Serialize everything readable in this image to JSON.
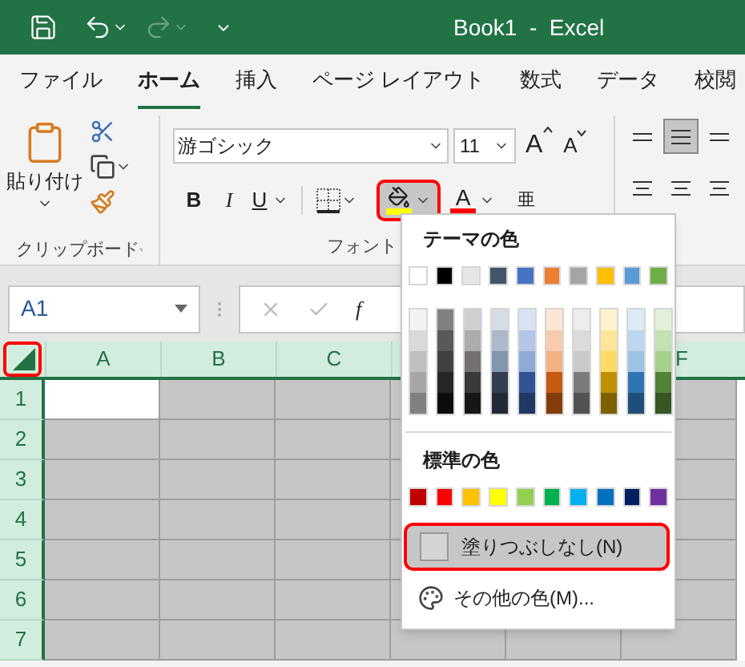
{
  "window": {
    "title": "Book1  -  Excel"
  },
  "quick_access": {
    "redo_disabled": true
  },
  "tabs": [
    {
      "label": "ファイル",
      "selected": false
    },
    {
      "label": "ホーム",
      "selected": true
    },
    {
      "label": "挿入",
      "selected": false
    },
    {
      "label": "ページ レイアウト",
      "selected": false
    },
    {
      "label": "数式",
      "selected": false
    },
    {
      "label": "データ",
      "selected": false
    },
    {
      "label": "校閲",
      "selected": false
    }
  ],
  "clipboard_group": {
    "paste_label": "貼り付け",
    "group_label": "クリップボード"
  },
  "font_group": {
    "font_name": "游ゴシック",
    "font_size": "11",
    "grow_label": "A",
    "shrink_label": "A",
    "bold_label": "B",
    "italic_label": "I",
    "underline_label": "U",
    "fill_bar": {
      "color": "#ffff00"
    },
    "fill_highlighted": true,
    "font_color_label": "A",
    "font_color_bar": {
      "color": "#ff0000"
    },
    "phonetic_label": "亜",
    "group_label": "フォント"
  },
  "alignment_buttons": [
    {
      "selected": false
    },
    {
      "selected": true
    },
    {
      "selected": false
    }
  ],
  "formula_bar": {
    "name_box": "A1",
    "function_label": "f"
  },
  "grid": {
    "select_all_highlighted": true,
    "all_selected": true,
    "columns": [
      {
        "label": "A"
      },
      {
        "label": "B"
      },
      {
        "label": "C"
      }
    ],
    "last_column": "F",
    "rows": [
      {
        "label": "1"
      },
      {
        "label": "2"
      },
      {
        "label": "3"
      },
      {
        "label": "4"
      },
      {
        "label": "5"
      },
      {
        "label": "6"
      },
      {
        "label": "7"
      }
    ]
  },
  "fill_menu": {
    "theme_title": "テーマの色",
    "theme_colors": [
      {
        "color": "#ffffff"
      },
      {
        "color": "#000000"
      },
      {
        "color": "#e7e6e6"
      },
      {
        "color": "#44546a"
      },
      {
        "color": "#4472c4"
      },
      {
        "color": "#ed7d31"
      },
      {
        "color": "#a5a5a5"
      },
      {
        "color": "#ffc000"
      },
      {
        "color": "#5b9bd5"
      },
      {
        "color": "#70ad47"
      }
    ],
    "shades": [
      {
        "colors": [
          {
            "color": "#f2f2f2"
          },
          {
            "color": "#d9d9d9"
          },
          {
            "color": "#bfbfbf"
          },
          {
            "color": "#a6a6a6"
          },
          {
            "color": "#808080"
          }
        ]
      },
      {
        "colors": [
          {
            "color": "#808080"
          },
          {
            "color": "#595959"
          },
          {
            "color": "#404040"
          },
          {
            "color": "#262626"
          },
          {
            "color": "#0d0d0d"
          }
        ]
      },
      {
        "colors": [
          {
            "color": "#d0cece"
          },
          {
            "color": "#aeabab"
          },
          {
            "color": "#757171"
          },
          {
            "color": "#3a3838"
          },
          {
            "color": "#171616"
          }
        ]
      },
      {
        "colors": [
          {
            "color": "#d6dce4"
          },
          {
            "color": "#adb9ca"
          },
          {
            "color": "#8497b0"
          },
          {
            "color": "#333f4f"
          },
          {
            "color": "#222a35"
          }
        ]
      },
      {
        "colors": [
          {
            "color": "#d9e2f3"
          },
          {
            "color": "#b4c6e7"
          },
          {
            "color": "#8eaadb"
          },
          {
            "color": "#2f5496"
          },
          {
            "color": "#1f3864"
          }
        ]
      },
      {
        "colors": [
          {
            "color": "#fbe5d5"
          },
          {
            "color": "#f7cbac"
          },
          {
            "color": "#f4b183"
          },
          {
            "color": "#c55a11"
          },
          {
            "color": "#843c0b"
          }
        ]
      },
      {
        "colors": [
          {
            "color": "#ededed"
          },
          {
            "color": "#dbdbdb"
          },
          {
            "color": "#c9c9c9"
          },
          {
            "color": "#7b7b7b"
          },
          {
            "color": "#525252"
          }
        ]
      },
      {
        "colors": [
          {
            "color": "#fff2cc"
          },
          {
            "color": "#fee599"
          },
          {
            "color": "#ffd965"
          },
          {
            "color": "#bf9000"
          },
          {
            "color": "#7f6000"
          }
        ]
      },
      {
        "colors": [
          {
            "color": "#deebf6"
          },
          {
            "color": "#bdd7ee"
          },
          {
            "color": "#9cc3e5"
          },
          {
            "color": "#2e75b5"
          },
          {
            "color": "#1e4e79"
          }
        ]
      },
      {
        "colors": [
          {
            "color": "#e2efd9"
          },
          {
            "color": "#c5e0b3"
          },
          {
            "color": "#a8d08d"
          },
          {
            "color": "#538135"
          },
          {
            "color": "#375623"
          }
        ]
      }
    ],
    "standard_title": "標準の色",
    "standard_colors": [
      {
        "color": "#c00000"
      },
      {
        "color": "#ff0000"
      },
      {
        "color": "#ffc000"
      },
      {
        "color": "#ffff00"
      },
      {
        "color": "#92d050"
      },
      {
        "color": "#00b050"
      },
      {
        "color": "#00b0f0"
      },
      {
        "color": "#0070c0"
      },
      {
        "color": "#002060"
      },
      {
        "color": "#7030a0"
      }
    ],
    "no_fill": {
      "label": "塗りつぶしなし(N)",
      "hovered": true,
      "highlighted": true
    },
    "more_colors": {
      "label": "その他の色(M)..."
    }
  }
}
